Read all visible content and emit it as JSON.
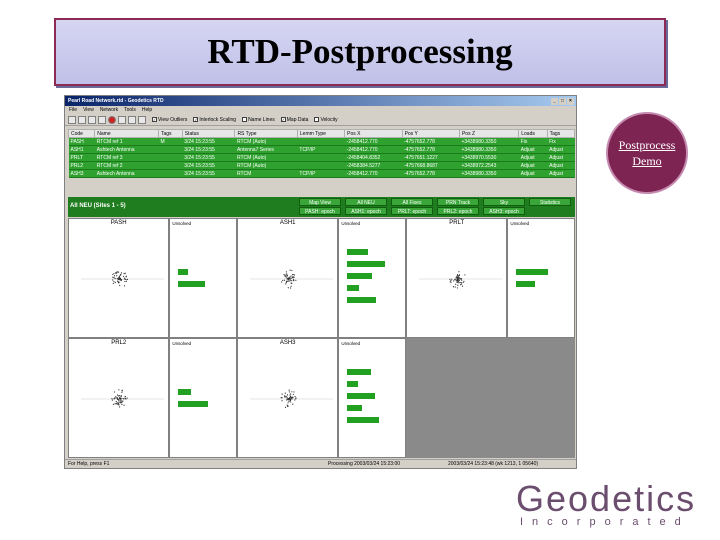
{
  "slide": {
    "title": "RTD-Postprocessing",
    "demo_line1": "Postprocess",
    "demo_line2": "Demo"
  },
  "app": {
    "window_title": "Pearl Road Network.rtd - Geodetics RTD",
    "menu": [
      "File",
      "View",
      "Network",
      "Tools",
      "Help"
    ],
    "toolbar_checks": [
      "View Outliers",
      "Interlock Scaling",
      "Name Lines",
      "Map Data",
      "Velocity"
    ],
    "toolbar_checked": [
      true,
      true,
      false,
      true,
      false
    ],
    "columns": [
      "Code",
      "Name",
      "Tags",
      "Status",
      "RS Type",
      "Lemm Type",
      "Pos X",
      "Pos Y",
      "Pos Z",
      "Loads",
      "Tags"
    ],
    "rows": [
      [
        "PASH",
        "RTCM ref 1",
        "M",
        "3/24 15:23:55",
        "RTCM (Auto)",
        "",
        "-2458412.770",
        "-4757652.778",
        "+3438980.3350",
        "Fix",
        "Fix"
      ],
      [
        "ASH1",
        "Ashtech Antenna",
        "",
        "3/24 15:23:55",
        "Antenna7 Series",
        "TCP/IP",
        "-2458412.770",
        "-4757652.778",
        "+3438980.3350",
        "Adjust",
        "Adjust"
      ],
      [
        "PRLT",
        "RTCM ref 3",
        "",
        "3/24 15:23:55",
        "RTCM (Auto)",
        "",
        "-2458404.8352",
        "-4757651.1227",
        "+3438970.5530",
        "Adjust",
        "Adjust"
      ],
      [
        "PRL2",
        "RTCM ref 2",
        "",
        "3/24 15:23:55",
        "RTCM (Auto)",
        "",
        "-2458384.5277",
        "-4757668.8687",
        "+3438972.2543",
        "Adjust",
        "Adjust"
      ],
      [
        "ASH3",
        "Ashtech Antenna",
        "",
        "3/24 15:23:55",
        "RTCM",
        "TCP/IP",
        "-2458412.770",
        "-4757652.778",
        "+3438980.3350",
        "Adjust",
        "Adjust"
      ]
    ],
    "view_title": "All NEU (Sites 1 - 5)",
    "tabs_top": [
      "Map View",
      "All NEU",
      "All Fixes",
      "PRN Track",
      "Sky",
      "Statistics"
    ],
    "tabs_bottom": [
      "PASH: epoch",
      "ASH1: epoch",
      "PRLT: epoch",
      "PRL2: epoch",
      "ASH3: epoch"
    ],
    "panels": [
      {
        "title": "PASH",
        "unsolved_label": "Unsolved"
      },
      {
        "title": "ASH1",
        "unsolved_label": "Unsolved"
      },
      {
        "title": "PRLT",
        "unsolved_label": "Unsolved"
      },
      {
        "title": "PRL2",
        "unsolved_label": "Unsolved"
      },
      {
        "title": "ASH3",
        "unsolved_label": "Unsolved"
      }
    ],
    "status": {
      "left": "For Help, press F1",
      "middle": "Processing 2003/03/24 15:23:00",
      "right": "2003/03/24 15:23:48 (wk 1213, 1 05640)"
    }
  },
  "logo": {
    "word": "Geodetics",
    "sub": "Incorporated"
  }
}
